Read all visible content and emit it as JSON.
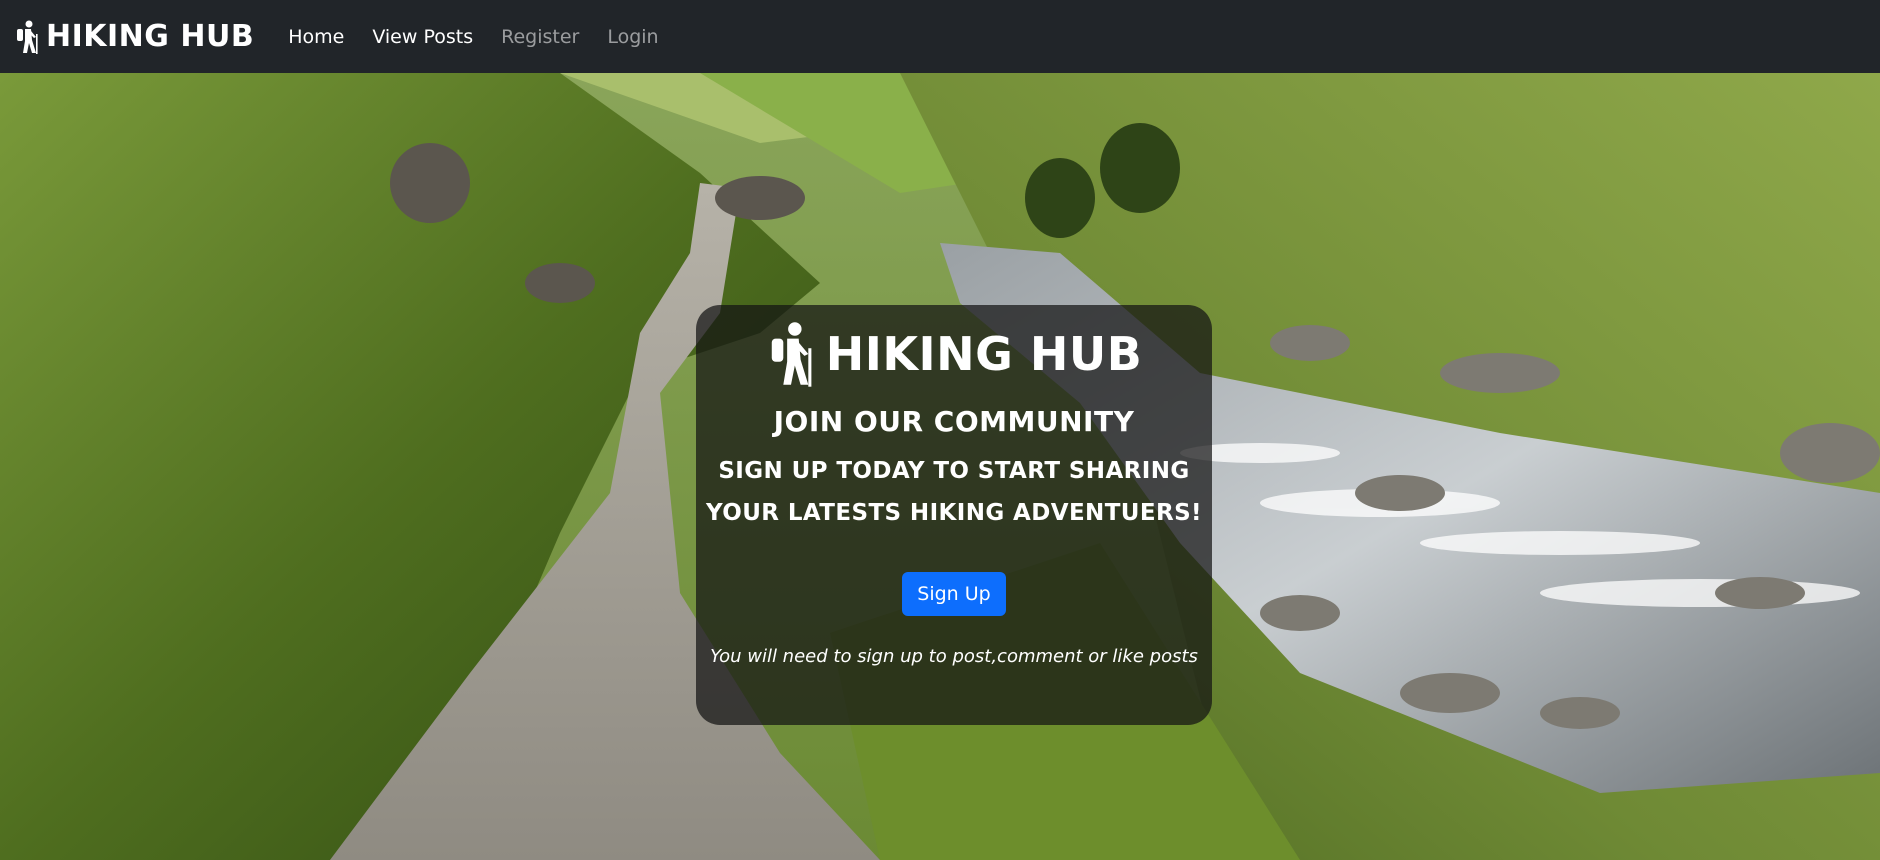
{
  "navbar": {
    "brand": "HIKING HUB",
    "brand_icon": "hiker-icon",
    "links": [
      {
        "label": "Home",
        "state": "active"
      },
      {
        "label": "View Posts",
        "state": "active"
      },
      {
        "label": "Register",
        "state": "muted"
      },
      {
        "label": "Login",
        "state": "muted"
      }
    ]
  },
  "hero": {
    "background": "mountain valley photo with gravel path and rocky stream"
  },
  "card": {
    "brand": "HIKING HUB",
    "heading": "JOIN OUR COMMUNITY",
    "subheading_line1": "SIGN UP TODAY TO START SHARING",
    "subheading_line2": "YOUR LATESTS HIKING ADVENTUERS!",
    "button_label": "Sign Up",
    "note": "You will need to sign up to post,comment or like posts"
  },
  "colors": {
    "navbar_bg": "#212529",
    "button_bg": "#0d6efd",
    "card_bg": "rgba(20,20,20,0.72)"
  }
}
